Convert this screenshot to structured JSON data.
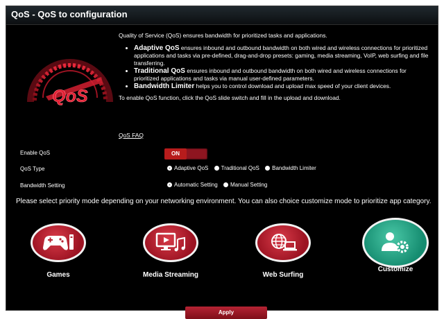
{
  "window": {
    "title": "QoS - QoS to configuration"
  },
  "intro": {
    "lead": "Quality of Service (QoS) ensures bandwidth for prioritized tasks and applications.",
    "items": [
      {
        "term": "Adaptive QoS",
        "text": " ensures inbound and outbound bandwidth on both wired and wireless connections for prioritized applications and tasks via pre-defined, drag-and-drop presets: gaming, media streaming, VoIP, web surfing and file transferring."
      },
      {
        "term": "Traditional QoS",
        "text": " ensures inbound and outbound bandwidth on both wired and wireless connections for prioritized applications and tasks via manual user-defined parameters."
      },
      {
        "term": "Bandwidth Limiter",
        "text": " helps you to control download and upload max speed of your client devices."
      }
    ],
    "enable_note": "To enable QoS function, click the QoS slide switch and fill in the upload and download.",
    "faq_link": "QoS FAQ"
  },
  "settings": {
    "enable_label": "Enable QoS",
    "enable_state": "ON",
    "type_label": "QoS Type",
    "type_options": [
      "Adaptive QoS",
      "Traditional QoS",
      "Bandwidth Limiter"
    ],
    "type_selected": "Adaptive QoS",
    "bandwidth_label": "Bandwidth Setting",
    "bandwidth_options": [
      "Automatic Setting",
      "Manual Setting"
    ],
    "bandwidth_selected": "Automatic Setting"
  },
  "priority_prompt": "Please select priority mode depending on your networking environment. You can also choice customize mode to prioritize app category.",
  "modes": [
    {
      "label": "Games",
      "icon": "gamepad-icon",
      "color": "#c62434"
    },
    {
      "label": "Media Streaming",
      "icon": "monitor-music-icon",
      "color": "#c62434"
    },
    {
      "label": "Web Surfing",
      "icon": "globe-laptop-icon",
      "color": "#c62434"
    },
    {
      "label": "Customize",
      "icon": "user-gear-icon",
      "color": "#23a888"
    }
  ],
  "apply_label": "Apply",
  "logo": {
    "text": "QoS",
    "icon": "speedometer-logo"
  },
  "colors": {
    "accent": "#b71c1c",
    "background": "#000000",
    "teal": "#23a888"
  }
}
